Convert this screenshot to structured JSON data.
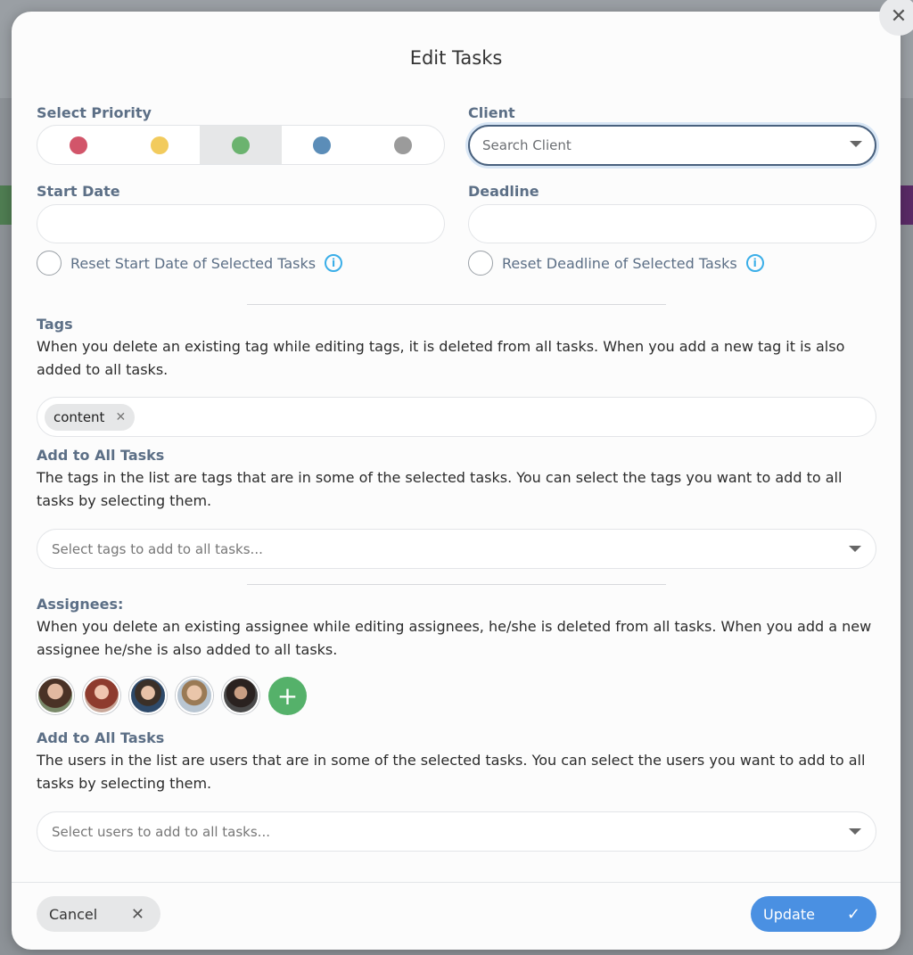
{
  "modal": {
    "title": "Edit Tasks",
    "close_icon": "close-icon"
  },
  "priority": {
    "label": "Select Priority",
    "options": [
      {
        "color": "#d2556a",
        "selected": false
      },
      {
        "color": "#f2cb5d",
        "selected": false
      },
      {
        "color": "#6bb36f",
        "selected": true
      },
      {
        "color": "#5b8db8",
        "selected": false
      },
      {
        "color": "#9b9b9b",
        "selected": false
      }
    ]
  },
  "client": {
    "label": "Client",
    "placeholder": "Search Client"
  },
  "start_date": {
    "label": "Start Date",
    "value": "",
    "reset_label": "Reset Start Date of Selected Tasks"
  },
  "deadline": {
    "label": "Deadline",
    "value": "",
    "reset_label": "Reset Deadline of Selected Tasks"
  },
  "tags": {
    "label": "Tags",
    "description": "When you delete an existing tag while editing tags, it is deleted from all tasks. When you add a new tag it is also added to all tasks.",
    "chips": [
      "content"
    ],
    "add_all_label": "Add to All Tasks",
    "add_all_description": "The tags in the list are tags that are in some of the selected tasks. You can select the tags you want to add to all tasks by selecting them.",
    "select_placeholder": "Select tags to add to all tasks..."
  },
  "assignees": {
    "label": "Assignees:",
    "description": "When you delete an existing assignee while editing assignees, he/she is deleted from all tasks. When you add a new assignee he/she is also added to all tasks.",
    "add_all_label": "Add to All Tasks",
    "add_all_description": "The users in the list are users that are in some of the selected tasks. You can select the users you want to add to all tasks by selecting them.",
    "select_placeholder": "Select users to add to all tasks..."
  },
  "footer": {
    "cancel_label": "Cancel",
    "update_label": "Update"
  },
  "colors": {
    "accent": "#4a90e2",
    "add_button": "#55b16a",
    "label_text": "#5c6f86"
  }
}
